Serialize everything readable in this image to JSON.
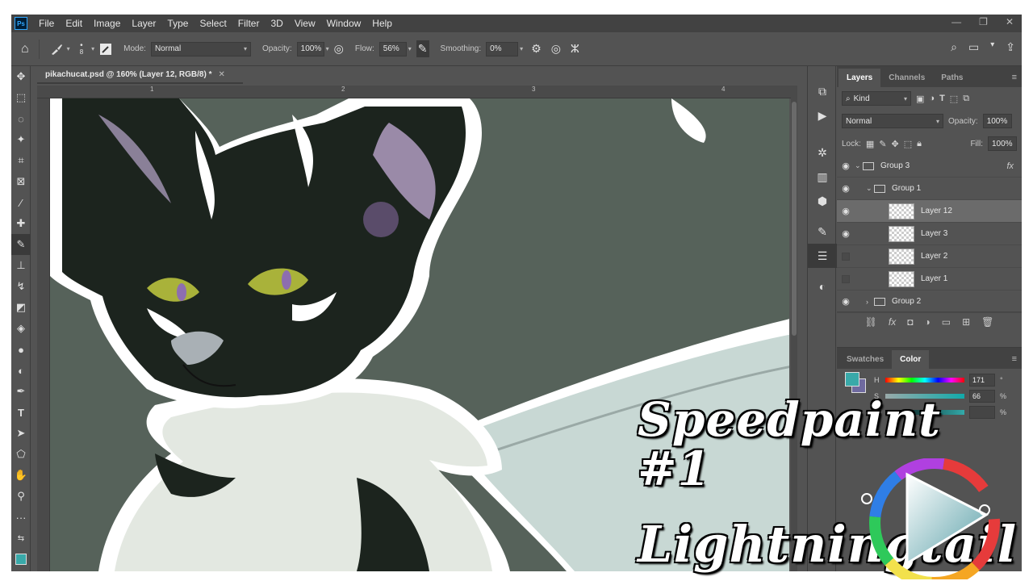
{
  "menu": {
    "app_logo": "Ps",
    "items": [
      "File",
      "Edit",
      "Image",
      "Layer",
      "Type",
      "Select",
      "Filter",
      "3D",
      "View",
      "Window",
      "Help"
    ],
    "window_controls": [
      "—",
      "❐",
      "✕"
    ]
  },
  "options": {
    "brush_size": "8",
    "mode_label": "Mode:",
    "mode_value": "Normal",
    "opacity_label": "Opacity:",
    "opacity_value": "100%",
    "flow_label": "Flow:",
    "flow_value": "56%",
    "smoothing_label": "Smoothing:",
    "smoothing_value": "0%"
  },
  "document": {
    "tab_title": "pikachucat.psd @ 160% (Layer 12, RGB/8) *",
    "ruler_ticks": [
      "1",
      "2",
      "3",
      "4"
    ]
  },
  "layers_panel": {
    "tabs": [
      "Layers",
      "Channels",
      "Paths"
    ],
    "filter_kind": "Kind",
    "blend_mode": "Normal",
    "opacity_label": "Opacity:",
    "opacity_value": "100%",
    "lock_label": "Lock:",
    "fill_label": "Fill:",
    "fill_value": "100%",
    "layers": [
      {
        "name": "Group 3",
        "type": "group",
        "visible": true,
        "expanded": true,
        "fx": "fx"
      },
      {
        "name": "Group 1",
        "type": "group",
        "visible": true,
        "expanded": true
      },
      {
        "name": "Layer 12",
        "type": "layer",
        "visible": true,
        "selected": true
      },
      {
        "name": "Layer 3",
        "type": "layer",
        "visible": true
      },
      {
        "name": "Layer 2",
        "type": "layer",
        "visible": false
      },
      {
        "name": "Layer 1",
        "type": "layer",
        "visible": false
      },
      {
        "name": "Group 2",
        "type": "group",
        "visible": true,
        "expanded": false
      }
    ]
  },
  "color_panel": {
    "tabs": [
      "Swatches",
      "Color"
    ],
    "h_label": "H",
    "h_value": "171",
    "h_unit": "°",
    "s_label": "S",
    "s_value": "66",
    "s_unit": "%",
    "b_label": "B",
    "b_unit": "%",
    "fg_color": "#39a9a9",
    "bg_color": "#6f6aa0"
  },
  "overlay": {
    "line1": "Speedpaint #1",
    "line2": "Lightningtail"
  },
  "colors": {
    "canvas_bg": "#56625a",
    "ui_dark": "#424242",
    "ui_mid": "#535353",
    "selection": "#6b6b6b"
  }
}
